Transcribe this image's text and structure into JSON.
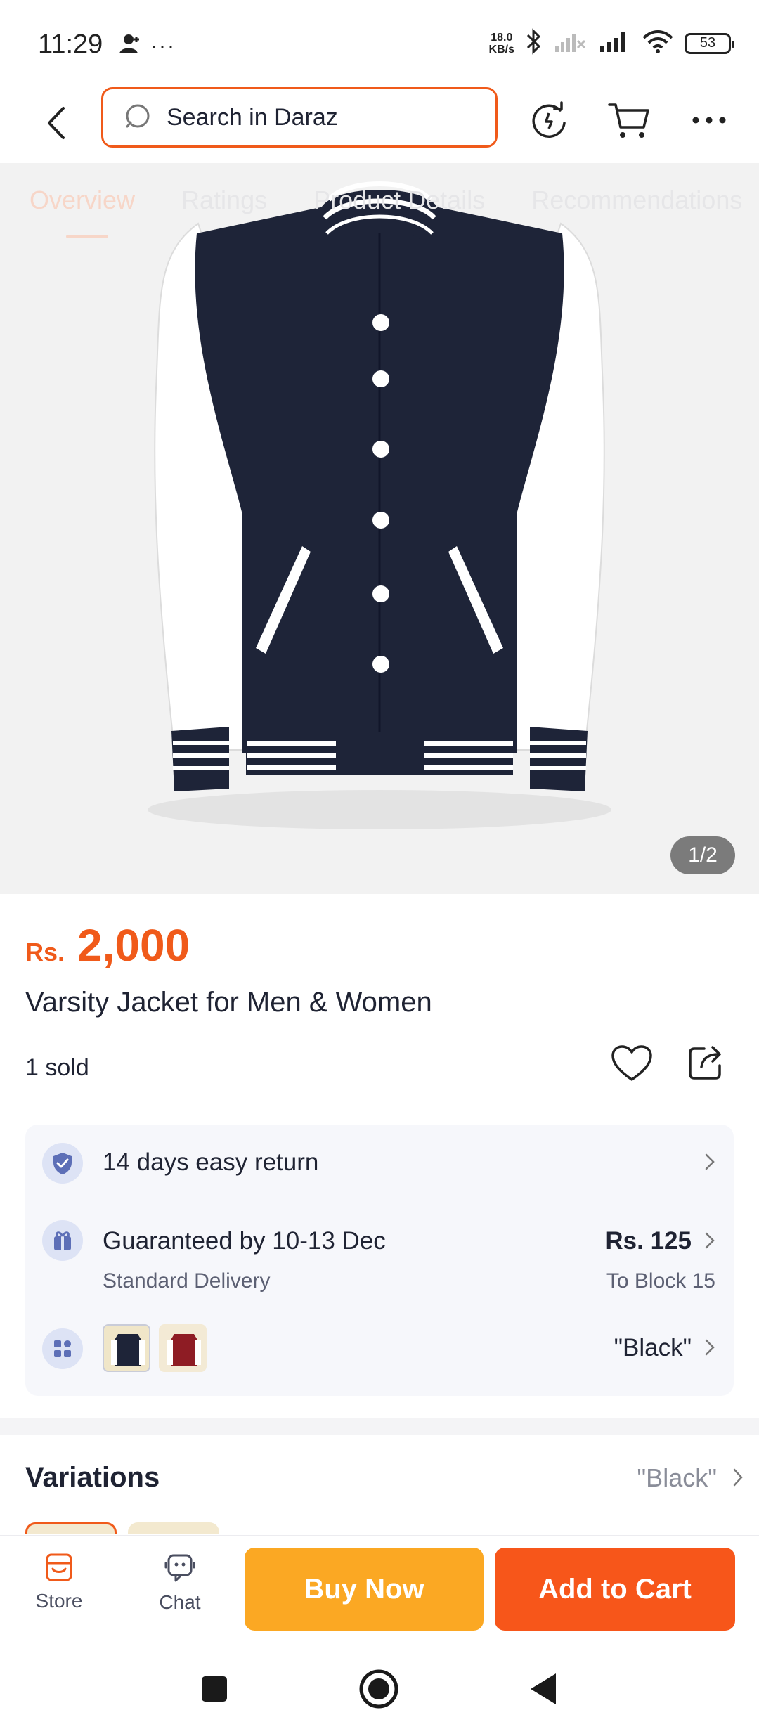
{
  "status_bar": {
    "time": "11:29",
    "more": "···",
    "net_speed_value": "18.0",
    "net_speed_unit": "KB/s",
    "battery": "53"
  },
  "header": {
    "search_placeholder": "Search in Daraz"
  },
  "tabs": [
    "Overview",
    "Ratings",
    "Product Details",
    "Recommendations"
  ],
  "gallery": {
    "page_indicator": "1/2"
  },
  "product": {
    "currency": "Rs.",
    "price": "2,000",
    "title": "Varsity Jacket for Men & Women",
    "sold": "1 sold"
  },
  "services": {
    "returns": "14 days easy return",
    "delivery_title": "Guaranteed by 10-13 Dec",
    "delivery_type": "Standard Delivery",
    "delivery_fee": "Rs. 125",
    "delivery_to": "To Block 15",
    "selected_variant": "\"Black\""
  },
  "variations": {
    "title": "Variations",
    "selected": "\"Black\""
  },
  "action_bar": {
    "store_label": "Store",
    "chat_label": "Chat",
    "buy_now": "Buy Now",
    "add_to_cart": "Add to Cart"
  },
  "colors": {
    "accent": "#f05a1a",
    "buy_now": "#fba823",
    "add_to_cart": "#f7561a",
    "jacket_body": "#1e2438"
  }
}
